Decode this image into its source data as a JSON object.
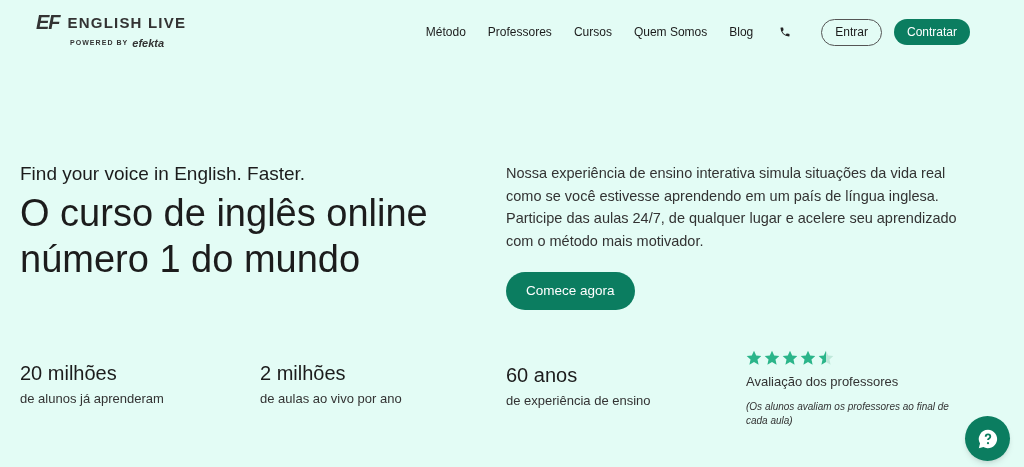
{
  "header": {
    "logo": {
      "mark": "EF",
      "name": "ENGLISH LIVE",
      "tagline": "POWERED BY",
      "brand": "efekta"
    },
    "nav": [
      {
        "label": "Método"
      },
      {
        "label": "Professores"
      },
      {
        "label": "Cursos"
      },
      {
        "label": "Quem Somos"
      },
      {
        "label": "Blog"
      }
    ],
    "login": "Entrar",
    "signup": "Contratar"
  },
  "hero": {
    "kicker": "Find your voice in English. Faster.",
    "title": "O curso de inglês online número 1 do mundo",
    "description": "Nossa experiência de ensino interativa simula situações da vida real como se você estivesse aprendendo em um país de língua inglesa. Participe das aulas 24/7, de qualquer lugar e acelere seu aprendizado com o método mais motivador.",
    "cta": "Comece agora"
  },
  "stats": [
    {
      "value": "20 milhões",
      "caption": "de alunos já aprenderam"
    },
    {
      "value": "2 milhões",
      "caption": "de aulas ao vivo por ano"
    },
    {
      "value": "60 anos",
      "caption": "de experiência de ensino"
    }
  ],
  "rating": {
    "stars": 4.5,
    "label": "Avaliação dos professores",
    "note": "(Os alunos avaliam os professores ao final de cada aula)"
  }
}
